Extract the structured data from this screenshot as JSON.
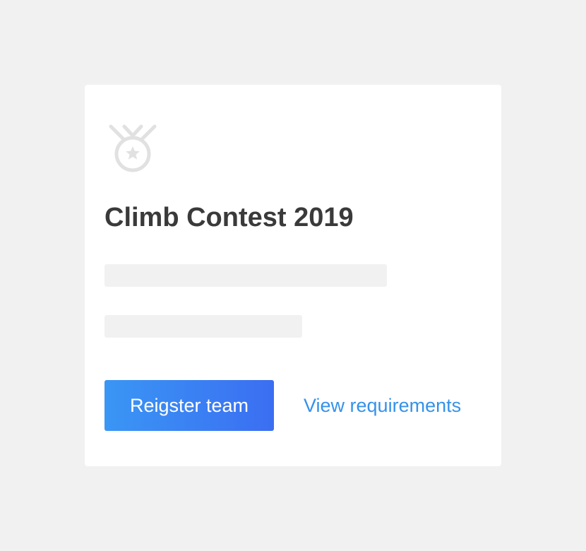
{
  "card": {
    "icon": "medal-icon",
    "title": "Climb Contest 2019",
    "register_label": "Reigster team",
    "requirements_label": "View requirements"
  },
  "colors": {
    "page_background": "#f1f1f1",
    "card_background": "#ffffff",
    "title": "#3a3a3a",
    "skeleton": "#f1f1f1",
    "button_gradient_start": "#3a96f4",
    "button_gradient_end": "#3b6ef2",
    "link": "#3592ea",
    "icon": "#e1e1e1"
  }
}
